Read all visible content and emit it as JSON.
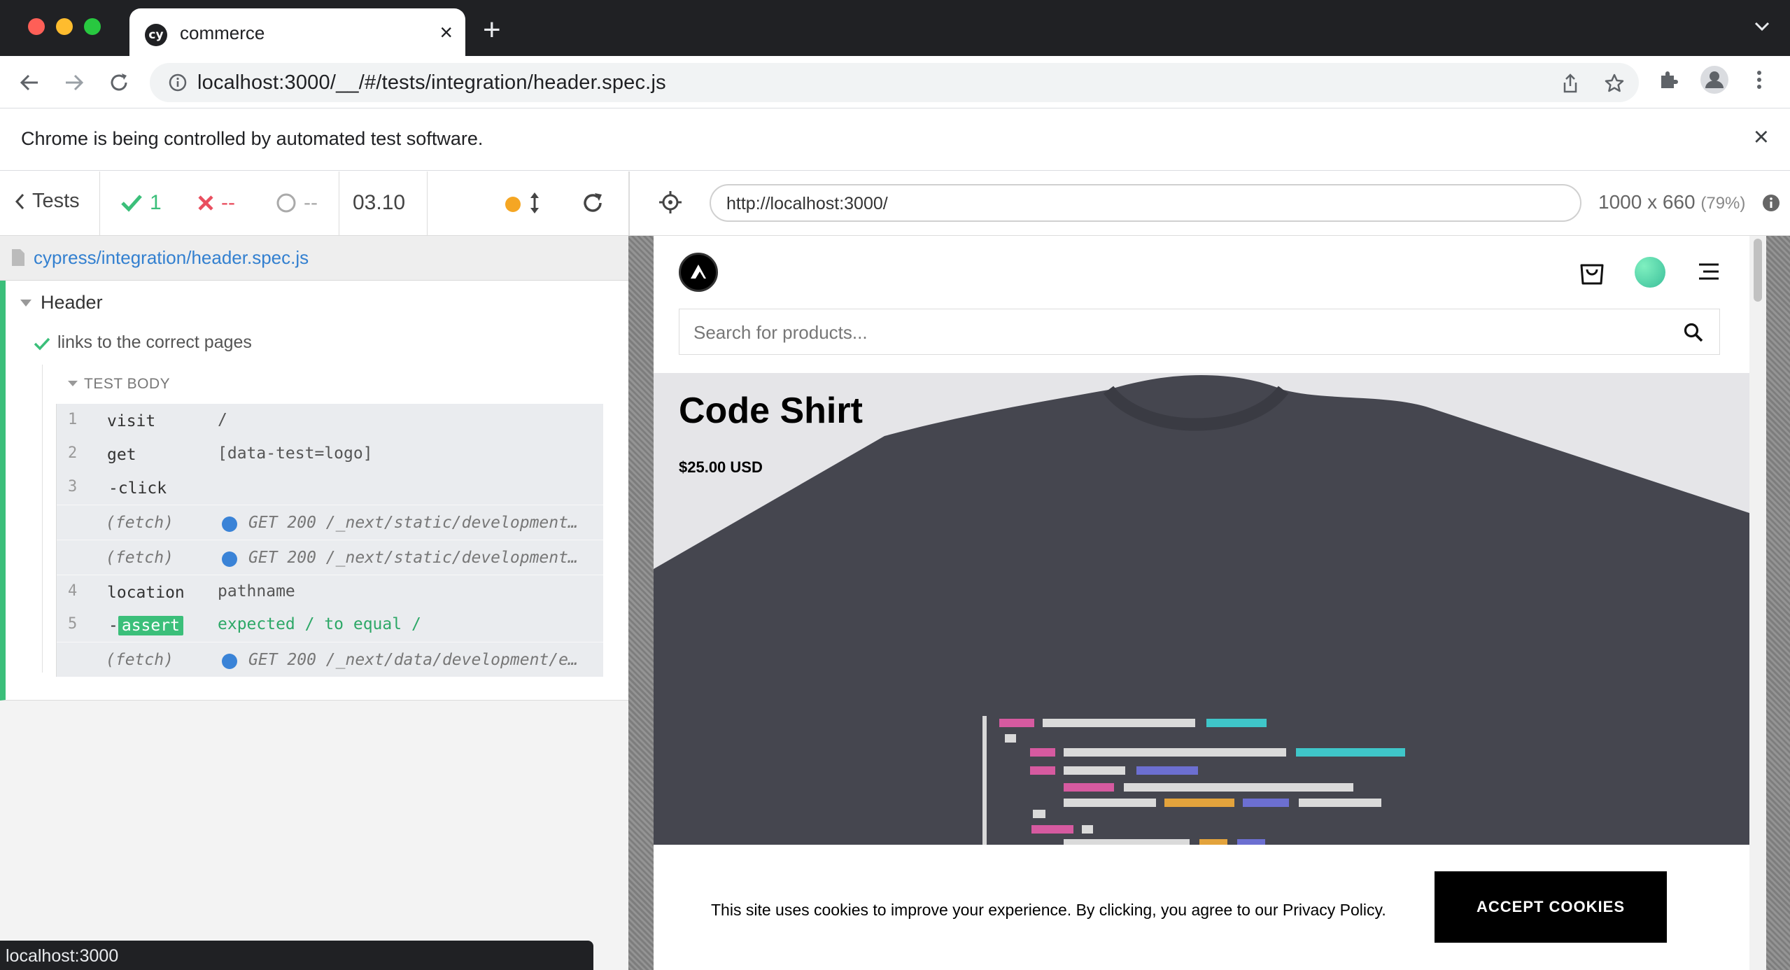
{
  "browser": {
    "tab_title": "commerce",
    "tab_favicon": "cy",
    "address": "localhost:3000/__/#/tests/integration/header.spec.js",
    "infobar_text": "Chrome is being controlled by automated test software.",
    "status_url": "localhost:3000"
  },
  "runner": {
    "tests_label": "Tests",
    "passed": "1",
    "failed": "--",
    "pending": "--",
    "duration": "03.10",
    "spec_path": "cypress/integration/header.spec.js",
    "suite": "Header",
    "test": "links to the correct pages",
    "test_body_label": "TEST BODY",
    "commands": [
      {
        "num": "1",
        "name": "visit",
        "msg": "/"
      },
      {
        "num": "2",
        "name": "get",
        "msg": "[data-test=logo]"
      },
      {
        "num": "3",
        "name": "-click",
        "msg": ""
      },
      {
        "num": "",
        "name": "(fetch)",
        "msg": "GET 200 /_next/static/development…"
      },
      {
        "num": "",
        "name": "(fetch)",
        "msg": "GET 200 /_next/static/development…"
      },
      {
        "num": "4",
        "name": "location",
        "msg": "pathname"
      },
      {
        "num": "5",
        "name": "assert",
        "prefix": "-",
        "msg": "expected / to equal /"
      },
      {
        "num": "",
        "name": "(fetch)",
        "msg": "GET 200 /_next/data/development/e…"
      }
    ]
  },
  "aut": {
    "url": "http://localhost:3000/",
    "viewport": "1000 x 660",
    "scale": "(79%)",
    "search_placeholder": "Search for products...",
    "product_title": "Code Shirt",
    "product_price": "$25.00 USD",
    "cookie_text": "This site uses cookies to improve your experience. By clicking, you agree to our Privacy Policy.",
    "cookie_button": "ACCEPT COOKIES"
  },
  "colors": {
    "pass": "#3bbf7a",
    "fail": "#e94f5f",
    "link": "#3380d0",
    "running": "#f5a623",
    "shirt": "#45464f"
  }
}
